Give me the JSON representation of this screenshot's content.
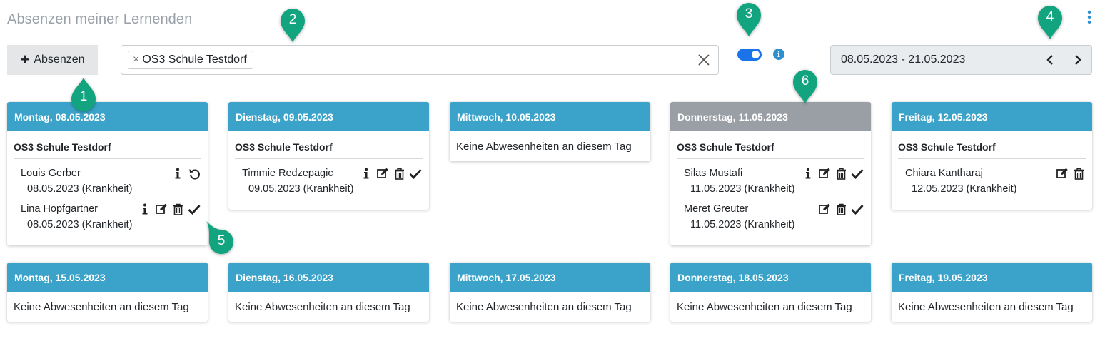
{
  "page": {
    "title": "Absenzen meiner Lernenden"
  },
  "toolbar": {
    "add_label": "Absenzen",
    "filter_chip": "OS3 Schule Testdorf",
    "date_range": "08.05.2023 - 21.05.2023",
    "toggle_on": true
  },
  "markers": [
    "1",
    "2",
    "3",
    "4",
    "5",
    "6"
  ],
  "colors": {
    "header": "#3ba3c9",
    "header_today": "#9a9fa5",
    "marker": "#12a37f",
    "toggle": "#1a73e8"
  },
  "week1": [
    {
      "day": "Montag, 08.05.2023",
      "school": "OS3 Schule Testdorf",
      "entries": [
        {
          "name": "Louis Gerber",
          "detail": "08.05.2023 (Krankheit)",
          "icons": [
            "info-icon",
            "undo-icon"
          ]
        },
        {
          "name": "Lina Hopfgartner",
          "detail": "08.05.2023 (Krankheit)",
          "icons": [
            "info-icon",
            "edit-icon",
            "trash-icon",
            "check-icon"
          ]
        }
      ]
    },
    {
      "day": "Dienstag, 09.05.2023",
      "school": "OS3 Schule Testdorf",
      "entries": [
        {
          "name": "Timmie Redzepagic",
          "detail": "09.05.2023 (Krankheit)",
          "icons": [
            "info-icon",
            "edit-icon",
            "trash-icon",
            "check-icon"
          ]
        }
      ]
    },
    {
      "day": "Mittwoch, 10.05.2023",
      "empty": "Keine Abwesenheiten an diesem Tag"
    },
    {
      "day": "Donnerstag, 11.05.2023",
      "school": "OS3 Schule Testdorf",
      "entries": [
        {
          "name": "Silas Mustafi",
          "detail": "11.05.2023 (Krankheit)",
          "icons": [
            "info-icon",
            "edit-icon",
            "trash-icon",
            "check-icon"
          ]
        },
        {
          "name": "Meret Greuter",
          "detail": "11.05.2023 (Krankheit)",
          "icons": [
            "edit-icon",
            "trash-icon",
            "check-icon"
          ]
        }
      ]
    },
    {
      "day": "Freitag, 12.05.2023",
      "school": "OS3 Schule Testdorf",
      "entries": [
        {
          "name": "Chiara Kantharaj",
          "detail": "12.05.2023 (Krankheit)",
          "icons": [
            "edit-icon",
            "trash-icon"
          ]
        }
      ]
    }
  ],
  "week2": [
    {
      "day": "Montag, 15.05.2023",
      "empty": "Keine Abwesenheiten an diesem Tag"
    },
    {
      "day": "Dienstag, 16.05.2023",
      "empty": "Keine Abwesenheiten an diesem Tag"
    },
    {
      "day": "Mittwoch, 17.05.2023",
      "empty": "Keine Abwesenheiten an diesem Tag"
    },
    {
      "day": "Donnerstag, 18.05.2023",
      "empty": "Keine Abwesenheiten an diesem Tag"
    },
    {
      "day": "Freitag, 19.05.2023",
      "empty": "Keine Abwesenheiten an diesem Tag"
    }
  ]
}
